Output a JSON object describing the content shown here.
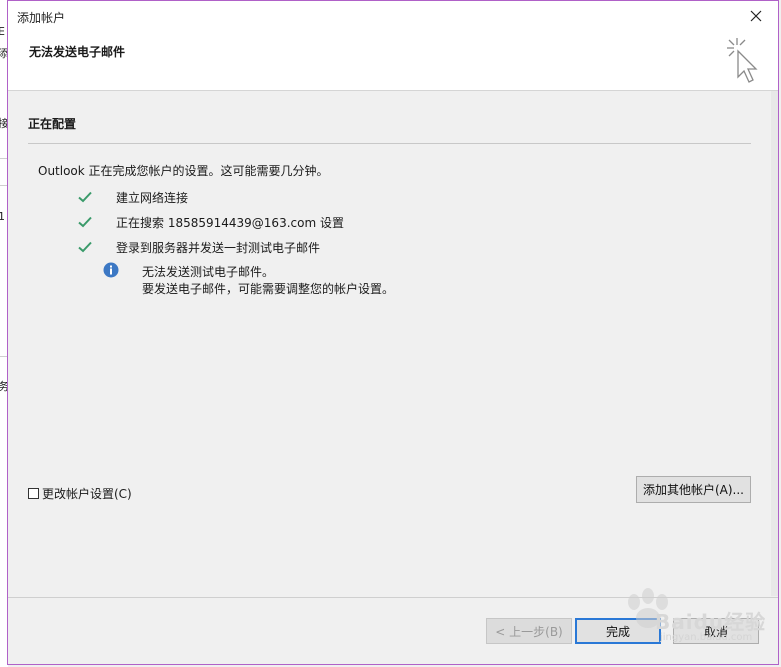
{
  "window": {
    "title": "添加帐户"
  },
  "header": {
    "title": "无法发送电子邮件"
  },
  "section": {
    "title": "正在配置"
  },
  "status": {
    "text": "Outlook 正在完成您帐户的设置。这可能需要几分钟。"
  },
  "steps": [
    {
      "label": "建立网络连接",
      "icon": "check-icon"
    },
    {
      "label": "正在搜索 18585914439@163.com 设置",
      "icon": "check-icon"
    },
    {
      "label": "登录到服务器并发送一封测试电子邮件",
      "icon": "check-icon"
    }
  ],
  "info": {
    "icon": "info-icon",
    "line1": "无法发送测试电子邮件。",
    "line2": "要发送电子邮件，可能需要调整您的帐户设置。"
  },
  "options": {
    "change_settings_label": "更改帐户设置(C)",
    "change_settings_checked": false
  },
  "buttons": {
    "add_other": "添加其他帐户(A)...",
    "back": "< 上一步(B)",
    "finish": "完成",
    "cancel": "取消"
  },
  "watermark": {
    "text": "Baidu经验",
    "url": "jingyan.baidu.com"
  },
  "colors": {
    "check": "#3a9a6a",
    "info": "#3c78c4",
    "accent_border": "#2a78d6",
    "window_border": "#b061c8"
  }
}
